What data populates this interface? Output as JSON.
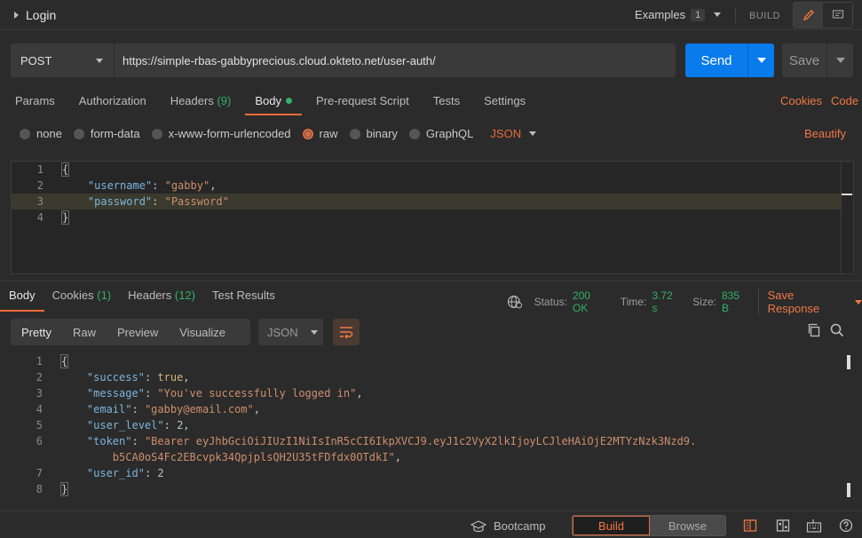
{
  "topbar": {
    "request_title": "Login",
    "examples_label": "Examples",
    "examples_count": "1",
    "build_label": "BUILD"
  },
  "request": {
    "method": "POST",
    "url": "https://simple-rbas-gabbyprecious.cloud.okteto.net/user-auth/",
    "send_label": "Send",
    "save_label": "Save"
  },
  "req_tabs": [
    {
      "label": "Params",
      "count": ""
    },
    {
      "label": "Authorization",
      "count": ""
    },
    {
      "label": "Headers",
      "count": "(9)"
    },
    {
      "label": "Body",
      "count": ""
    },
    {
      "label": "Pre-request Script",
      "count": ""
    },
    {
      "label": "Tests",
      "count": ""
    },
    {
      "label": "Settings",
      "count": ""
    }
  ],
  "cookies_label": "Cookies",
  "code_label": "Code",
  "body_types": [
    "none",
    "form-data",
    "x-www-form-urlencoded",
    "raw",
    "binary",
    "GraphQL"
  ],
  "body_format": "JSON",
  "beautify_label": "Beautify",
  "request_body": {
    "line_numbers": [
      "1",
      "2",
      "3",
      "4"
    ],
    "lines": {
      "l1": "{",
      "l2_key": "\"username\"",
      "l2_val": "\"gabby\"",
      "l3_key": "\"password\"",
      "l3_val": "\"Password\"",
      "l4": "}"
    }
  },
  "res_tabs": [
    {
      "label": "Body",
      "count": ""
    },
    {
      "label": "Cookies",
      "count": "(1)"
    },
    {
      "label": "Headers",
      "count": "(12)"
    },
    {
      "label": "Test Results",
      "count": ""
    }
  ],
  "status": {
    "status_label": "Status:",
    "status_value": "200 OK",
    "time_label": "Time:",
    "time_value": "3.72 s",
    "size_label": "Size:",
    "size_value": "835 B",
    "save_response": "Save Response"
  },
  "view_tabs": [
    "Pretty",
    "Raw",
    "Preview",
    "Visualize"
  ],
  "response_format": "JSON",
  "response_body": {
    "line_numbers": [
      "1",
      "2",
      "3",
      "4",
      "5",
      "6",
      "7",
      "8"
    ],
    "open": "{",
    "close": "}",
    "success_key": "\"success\"",
    "success_val": "true",
    "message_key": "\"message\"",
    "message_val": "\"You've successfully logged in\"",
    "email_key": "\"email\"",
    "email_val": "\"gabby@email.com\"",
    "level_key": "\"user_level\"",
    "level_val": "2",
    "token_key": "\"token\"",
    "token_val_1": "\"Bearer eyJhbGciOiJIUzI1NiIsInR5cCI6IkpXVCJ9.eyJ1c2VyX2lkIjoyLCJleHAiOjE2MTYzNzk3Nzd9.",
    "token_val_2": "b5CA0oS4Fc2EBcvpk34QpjplsQH2U35tFDfdx0OTdkI\"",
    "id_key": "\"user_id\"",
    "id_val": "2"
  },
  "footer": {
    "bootcamp": "Bootcamp",
    "build": "Build",
    "browse": "Browse"
  },
  "colors": {
    "accent": "#f07844",
    "send_blue": "#097bed",
    "success_green": "#33b066"
  }
}
